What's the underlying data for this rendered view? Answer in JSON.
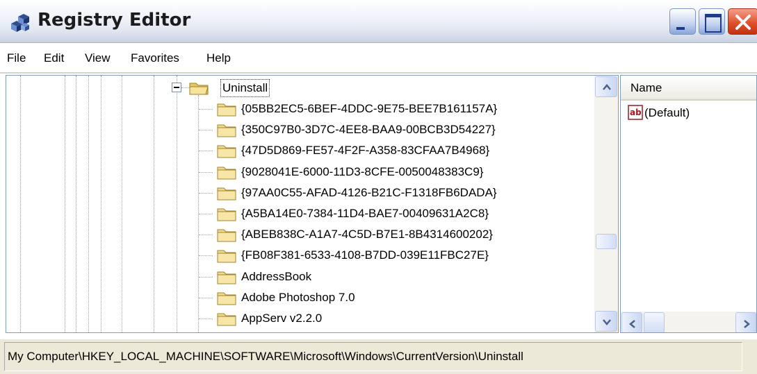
{
  "window": {
    "title": "Registry Editor",
    "icon": "registry-cubes-icon"
  },
  "menu": [
    "File",
    "Edit",
    "View",
    "Favorites",
    "Help"
  ],
  "tree": {
    "selected": "Uninstall",
    "children": [
      "{05BB2EC5-6BEF-4DDC-9E75-BEE7B161157A}",
      "{350C97B0-3D7C-4EE8-BAA9-00BCB3D54227}",
      "{47D5D869-FE57-4F2F-A358-83CFAA7B4968}",
      "{9028041E-6000-11D3-8CFE-0050048383C9}",
      "{97AA0C55-AFAD-4126-B21C-F1318FB6DADA}",
      "{A5BA14E0-7384-11D4-BAE7-00409631A2C8}",
      "{ABEB838C-A1A7-4C5D-B7E1-8B4314600202}",
      "{FB08F381-6533-4108-B7DD-039E11FBC27E}",
      "AddressBook",
      "Adobe Photoshop 7.0",
      "AppServ v2.2.0"
    ]
  },
  "values": {
    "column_name": "Name",
    "rows": [
      {
        "name": "(Default)",
        "icon": "string-value-ab-icon"
      }
    ]
  },
  "statusbar": {
    "path": "My Computer\\HKEY_LOCAL_MACHINE\\SOFTWARE\\Microsoft\\Windows\\CurrentVersion\\Uninstall"
  },
  "colors": {
    "title_close": "#e0522d",
    "folder": "#f2d98a",
    "pane_border": "#7f9db9"
  }
}
